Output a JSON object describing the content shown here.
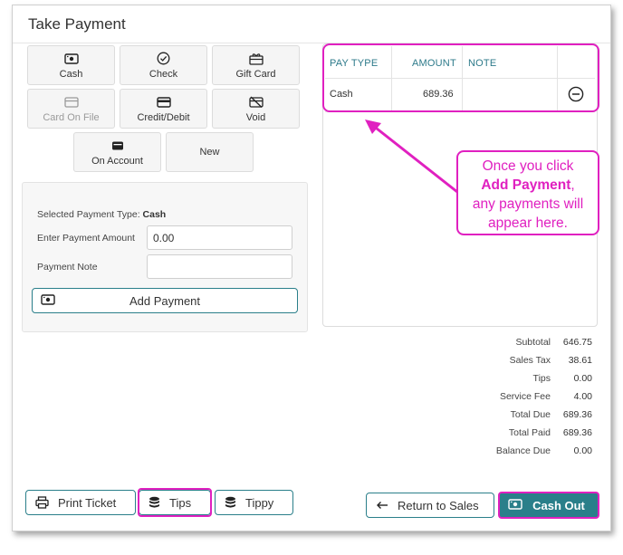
{
  "header": {
    "title": "Take Payment"
  },
  "payment_types": [
    {
      "label": "Cash",
      "icon": "cash-icon",
      "disabled": false
    },
    {
      "label": "Check",
      "icon": "check-circle-icon",
      "disabled": false
    },
    {
      "label": "Gift Card",
      "icon": "gift-card-icon",
      "disabled": false
    },
    {
      "label": "Card On File",
      "icon": "card-icon",
      "disabled": true
    },
    {
      "label": "Credit/Debit",
      "icon": "credit-card-icon",
      "disabled": false
    },
    {
      "label": "Void",
      "icon": "void-card-icon",
      "disabled": false
    },
    {
      "label": "On Account",
      "icon": "wallet-icon",
      "disabled": false
    },
    {
      "label": "New",
      "icon": "",
      "disabled": false
    }
  ],
  "form": {
    "selected_label": "Selected Payment Type:",
    "selected_value": "Cash",
    "amount_label": "Enter Payment Amount",
    "amount_value": "0.00",
    "note_label": "Payment Note",
    "note_value": "",
    "add_button": "Add Payment"
  },
  "payments_table": {
    "headers": [
      "PAY TYPE",
      "AMOUNT",
      "NOTE",
      ""
    ],
    "rows": [
      {
        "pay_type": "Cash",
        "amount": "689.36",
        "note": ""
      }
    ]
  },
  "callout": {
    "line1": "Once you click",
    "bold": "Add Payment",
    "after_bold": ",",
    "line3": "any payments will",
    "line4": "appear here."
  },
  "summary": [
    {
      "label": "Subtotal",
      "value": "646.75"
    },
    {
      "label": "Sales Tax",
      "value": "38.61"
    },
    {
      "label": "Tips",
      "value": "0.00"
    },
    {
      "label": "Service Fee",
      "value": "4.00"
    },
    {
      "label": "Total Due",
      "value": "689.36"
    },
    {
      "label": "Total Paid",
      "value": "689.36"
    },
    {
      "label": "Balance Due",
      "value": "0.00"
    }
  ],
  "footer": {
    "print_ticket": "Print Ticket",
    "tips": "Tips",
    "tippy": "Tippy",
    "return_to_sales": "Return to Sales",
    "cash_out": "Cash Out"
  },
  "colors": {
    "accent": "#2a7f8a",
    "highlight": "#e020c0"
  }
}
